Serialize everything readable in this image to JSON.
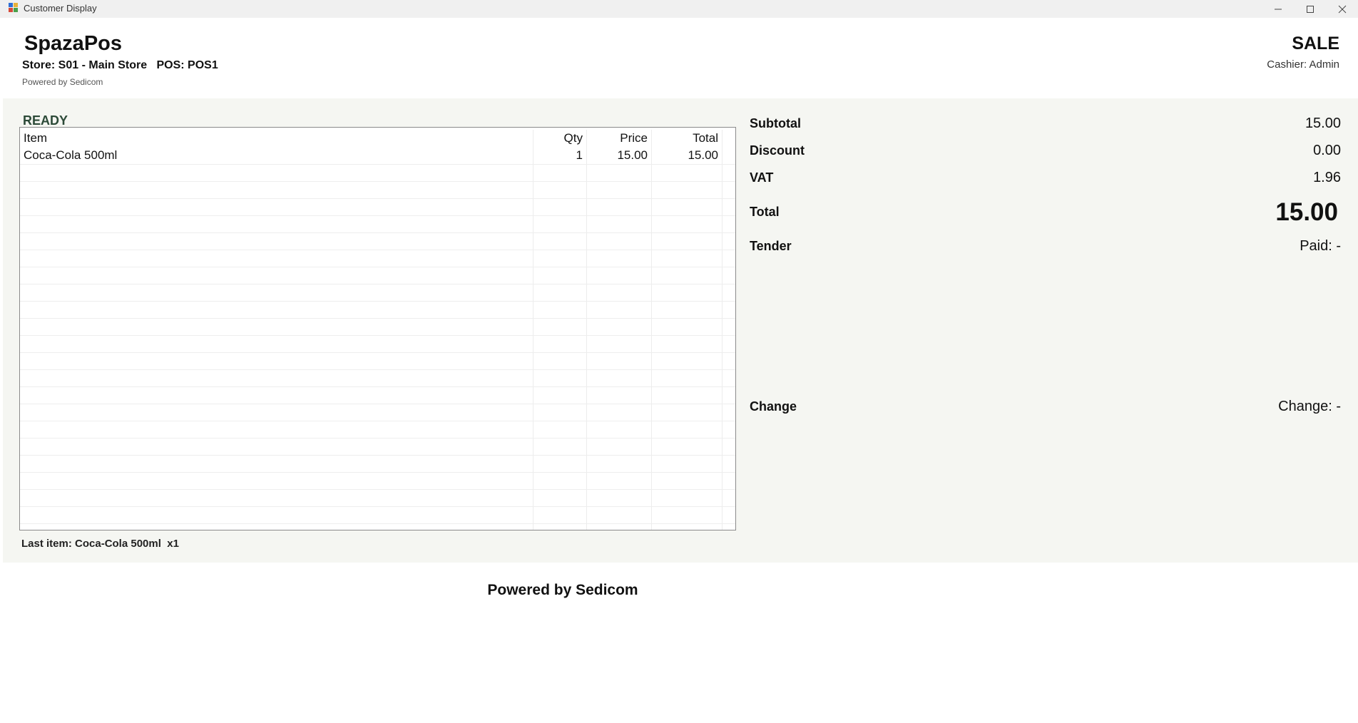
{
  "window": {
    "title": "Customer Display",
    "icon": "app-window-icon",
    "controls": {
      "minimize": "—",
      "maximize": "☐",
      "close": "✕"
    }
  },
  "header": {
    "brand": "SpazaPos",
    "store_line": "Store: S01 - Main Store   POS: POS1",
    "powered": "Powered by Sedicom",
    "mode": "SALE",
    "cashier": "Cashier: Admin"
  },
  "status": "READY",
  "grid": {
    "columns": [
      "Item",
      "Qty",
      "Price",
      "Total"
    ],
    "rows": [
      {
        "item": "Coca-Cola 500ml",
        "qty": "1",
        "price": "15.00",
        "total": "15.00"
      }
    ]
  },
  "summary": {
    "subtotal_label": "Subtotal",
    "subtotal_value": "15.00",
    "discount_label": "Discount",
    "discount_value": "0.00",
    "vat_label": "VAT",
    "vat_value": "1.96",
    "total_label": "Total",
    "total_value": "15.00",
    "tender_label": "Tender",
    "tender_value": "Paid: -",
    "change_label": "Change",
    "change_value": "Change: -"
  },
  "last_item": "Last item: Coca-Cola 500ml  x1",
  "footer": "Powered by Sedicom"
}
